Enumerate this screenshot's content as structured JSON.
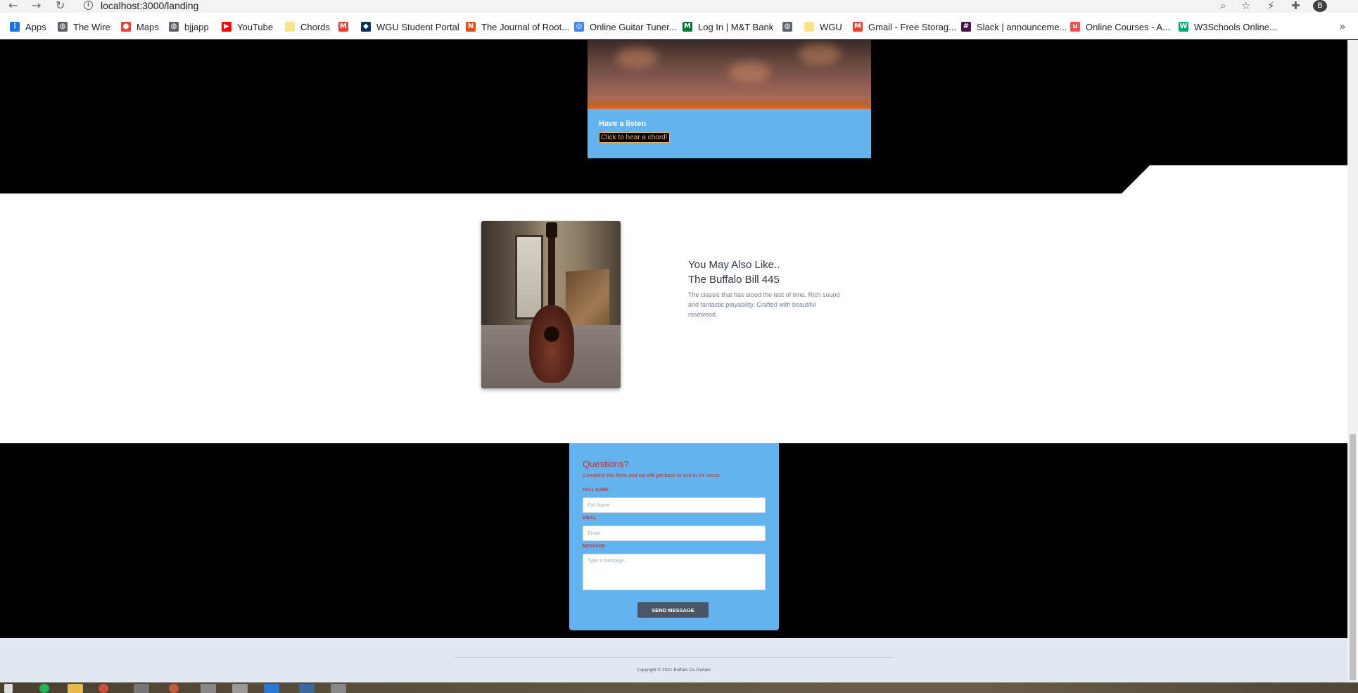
{
  "browser": {
    "url": "localhost:3000/landing",
    "avatar_letter": "B",
    "bookmarks": [
      {
        "label": "Apps",
        "icon": "apps-grid-icon",
        "color": "#1a73e8"
      },
      {
        "label": "The Wire",
        "icon": "globe-icon",
        "color": "#5f6368"
      },
      {
        "label": "Maps",
        "icon": "maps-pin-icon",
        "color": "#ea4335"
      },
      {
        "label": "bjjapp",
        "icon": "globe-icon",
        "color": "#5f6368"
      },
      {
        "label": "YouTube",
        "icon": "youtube-icon",
        "color": "#ff0000"
      },
      {
        "label": "Chords",
        "icon": "folder-icon",
        "color": "#fbe38b"
      },
      {
        "label": "",
        "icon": "gmail-icon",
        "color": "#ea4335"
      },
      {
        "label": "WGU Student Portal",
        "icon": "owl-icon",
        "color": "#003057"
      },
      {
        "label": "The Journal of Root...",
        "icon": "nd-icon",
        "color": "#e44d26"
      },
      {
        "label": "Online Guitar Tuner...",
        "icon": "tuner-icon",
        "color": "#4285f4"
      },
      {
        "label": "Log In | M&T Bank",
        "icon": "mt-bank-icon",
        "color": "#007a33"
      },
      {
        "label": "",
        "icon": "globe-icon",
        "color": "#5f6368"
      },
      {
        "label": "WGU",
        "icon": "folder-icon",
        "color": "#fbe38b"
      },
      {
        "label": "Gmail - Free Storag...",
        "icon": "gmail-icon",
        "color": "#ea4335"
      },
      {
        "label": "Slack | announceme...",
        "icon": "slack-icon",
        "color": "#4a154b"
      },
      {
        "label": "Online Courses - A...",
        "icon": "udemy-icon",
        "color": "#ec5252"
      },
      {
        "label": "W3Schools Online...",
        "icon": "w3schools-icon",
        "color": "#04aa6d"
      }
    ]
  },
  "listen_card": {
    "title": "Have a listen",
    "button": "Click to hear a chord!"
  },
  "also_like": {
    "heading_line1": "You May Also Like..",
    "heading_line2": "The Buffalo Bill 445",
    "description": "The classic that has stood the test of time. Rich sound and fantastic playability. Crafted with beautiful rosewood."
  },
  "contact_form": {
    "title": "Questions?",
    "subtitle": "Complete this form and we will get back to you in 24 hours.",
    "fullname_label": "FULL NAME",
    "fullname_placeholder": "Full Name",
    "email_label": "EMAIL",
    "email_placeholder": "Email",
    "message_label": "MESSAGE",
    "message_placeholder": "Type a message...",
    "submit": "SEND MESSAGE"
  },
  "footer": {
    "copyright": "Copyright © 2021 Buffalo Co Guitars"
  },
  "colors": {
    "card_blue": "#63b3ed",
    "form_red": "#c53030",
    "button_slate": "#4a5568",
    "footer_bg": "#e2e8f0"
  }
}
